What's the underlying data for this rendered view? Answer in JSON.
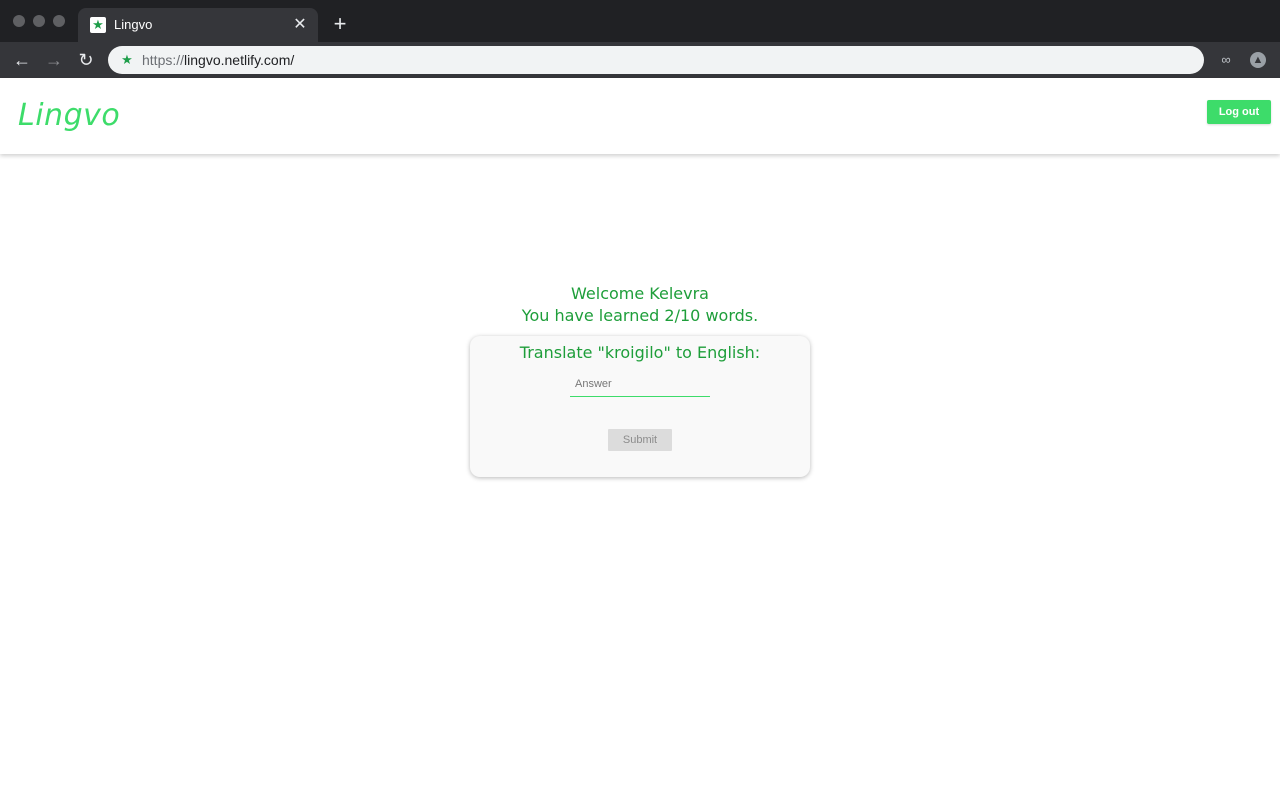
{
  "browser": {
    "tab_title": "Lingvo",
    "favicon": "star-icon",
    "url_scheme": "https://",
    "url_host": "lingvo.netlify.com/",
    "new_tab_symbol": "+",
    "close_symbol": "✕"
  },
  "header": {
    "logo": "Lingvo",
    "logout_label": "Log out"
  },
  "welcome": {
    "line1": "Welcome Kelevra",
    "line2": "You have learned 2/10 words."
  },
  "quiz": {
    "prompt": "Translate \"kroigilo\" to English:",
    "answer_placeholder": "Answer",
    "answer_value": "",
    "submit_label": "Submit"
  },
  "colors": {
    "brand": "#3ddc6a",
    "text_green": "#1e9e3a"
  }
}
